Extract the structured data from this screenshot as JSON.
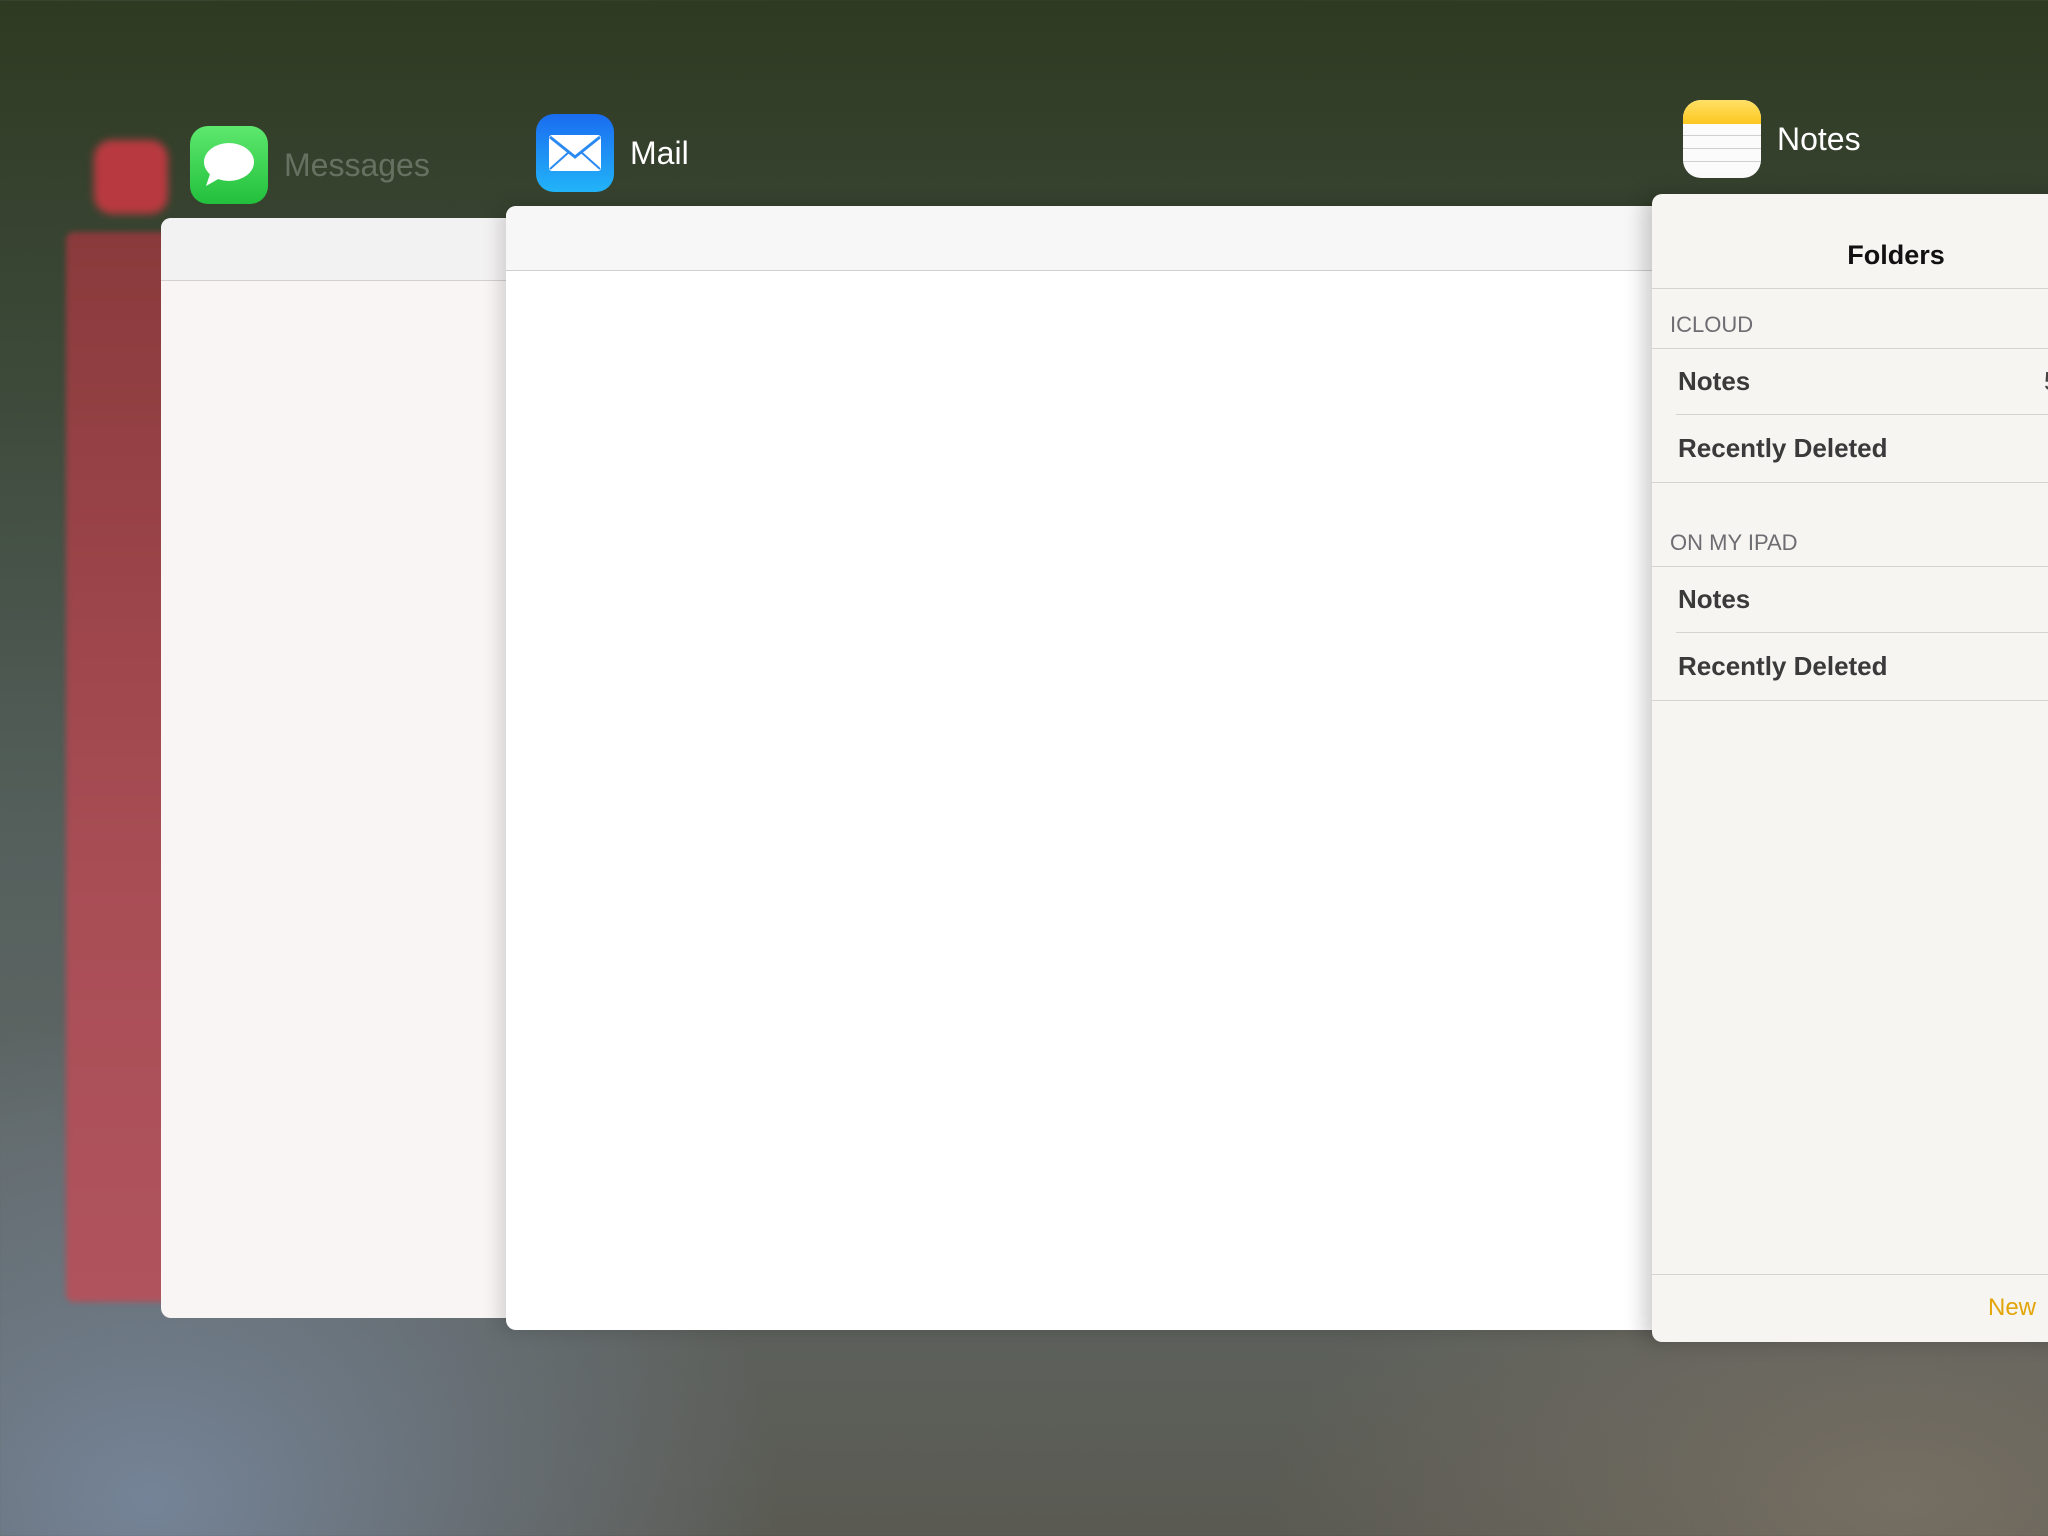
{
  "apps": {
    "messages": {
      "name": "Messages"
    },
    "mail": {
      "name": "Mail"
    },
    "notes": {
      "name": "Notes",
      "title": "Folders",
      "sections": [
        {
          "header": "ICLOUD",
          "rows": [
            {
              "label": "Notes",
              "count": "5"
            },
            {
              "label": "Recently Deleted"
            }
          ]
        },
        {
          "header": "ON MY IPAD",
          "rows": [
            {
              "label": "Notes"
            },
            {
              "label": "Recently Deleted"
            }
          ]
        }
      ],
      "new_button": "New"
    }
  },
  "colors": {
    "messages_icon": "#2fc84a",
    "mail_icon": "#1e8cf0",
    "notes_icon": "#ffd23a",
    "notes_accent": "#e3a508"
  }
}
